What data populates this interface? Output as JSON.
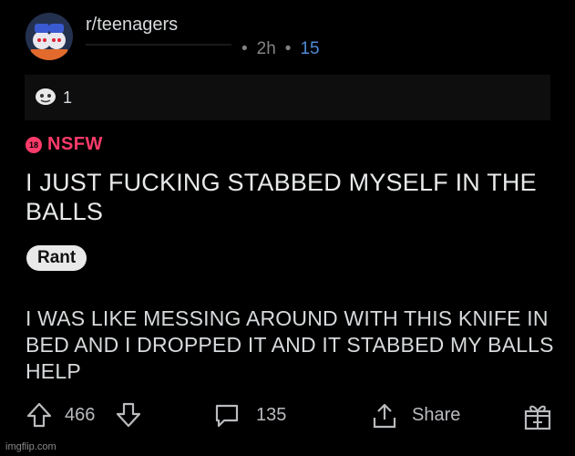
{
  "header": {
    "subreddit": "r/teenagers",
    "time": "2h",
    "award_count": "15"
  },
  "awards": {
    "count": "1"
  },
  "nsfw": {
    "badge": "18",
    "label": "NSFW"
  },
  "post": {
    "title": "I JUST FUCKING STABBED MYSELF IN THE BALLS",
    "flair": "Rant",
    "body": "I WAS LIKE MESSING AROUND WITH THIS KNIFE IN BED AND I DROPPED IT AND IT STABBED MY BALLS HELP"
  },
  "actions": {
    "score": "466",
    "comments": "135",
    "share_label": "Share"
  },
  "watermark": "imgflip.com",
  "icons": [
    "avatar",
    "award-icon",
    "upvote-icon",
    "downvote-icon",
    "comment-icon",
    "share-icon",
    "gift-icon"
  ],
  "colors": {
    "nsfw": "#ff3b6b",
    "award_count": "#4f8ad6",
    "background": "#000000"
  }
}
